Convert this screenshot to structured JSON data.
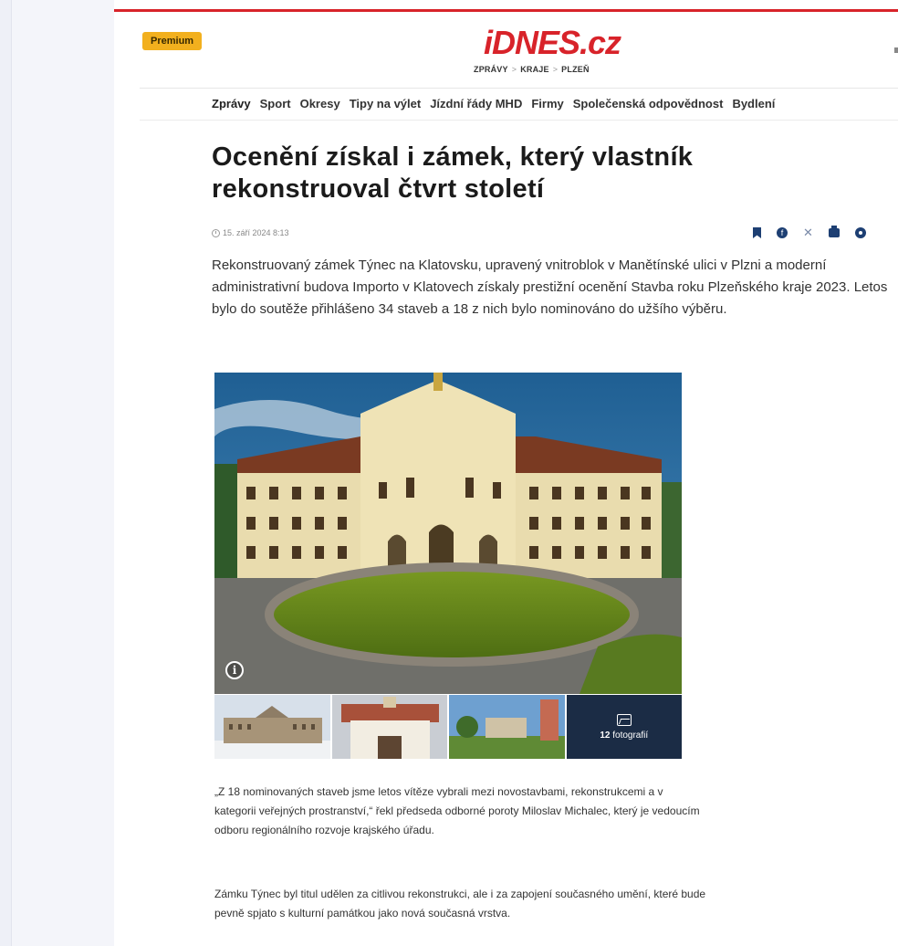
{
  "header": {
    "premium_label": "Premium",
    "logo_main": "iDNES",
    "logo_dot": ".cz",
    "breadcrumb": [
      "ZPRÁVY",
      "KRAJE",
      "PLZEŇ"
    ],
    "brand_color": "#d8232a"
  },
  "nav": {
    "items": [
      "Zprávy",
      "Sport",
      "Okresy",
      "Tipy na výlet",
      "Jízdní řády MHD",
      "Firmy",
      "Společenská odpovědnost",
      "Bydlení"
    ]
  },
  "article": {
    "title": "Ocenění získal i zámek, který vlastník rekonstruoval čtvrt století",
    "date": "15. září 2024  8:13",
    "lead": "Rekonstruovaný zámek Týnec na Klatovsku, upravený vnitroblok v Manětínské ulici v Plzni a moderní administrativní budova Importo v Klatovech získaly prestižní ocenění Stavba roku Plzeňského kraje 2023. Letos bylo do soutěže přihlášeno 34 staveb a 18 z nich bylo nominováno do užšího výběru.",
    "gallery": {
      "count_number": "12",
      "count_label": "fotografií"
    },
    "paragraphs": [
      "„Z 18 nominovaných staveb jsme letos vítěze vybrali mezi novostavbami, rekonstrukcemi a v kategorii veřejných prostranství,“ řekl předseda odborné poroty Miloslav Michalec, který je vedoucím odboru regionálního rozvoje krajského úřadu.",
      "Zámku Týnec byl titul udělen za citlivou rekonstrukci, ale i za zapojení současného umění, které bude pevně spjato s kulturní památkou jako nová současná vrstva."
    ]
  },
  "share_icons": [
    "bookmark-icon",
    "facebook-icon",
    "x-icon",
    "print-icon",
    "comments-icon"
  ]
}
